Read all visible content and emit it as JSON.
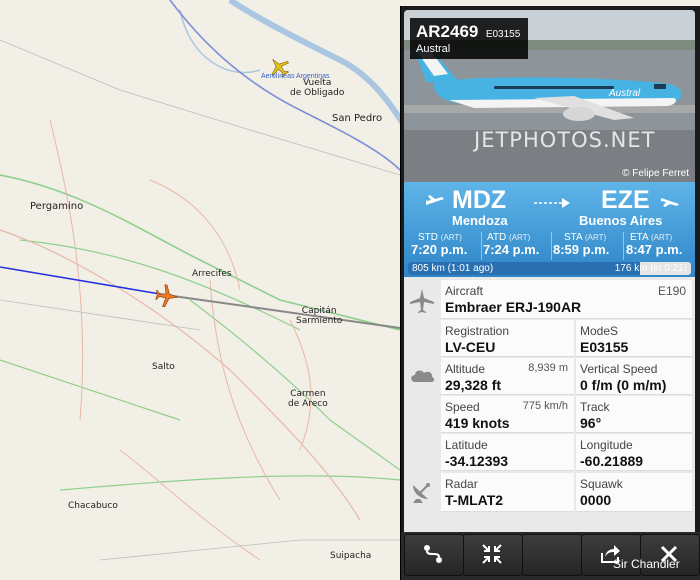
{
  "map": {
    "cities": [
      {
        "name": "Vuelta de Obligado",
        "line1": "Vuelta",
        "line2": "de Obligado"
      },
      {
        "name": "San Pedro"
      },
      {
        "name": "Pergamino"
      },
      {
        "name": "Arrecifes"
      },
      {
        "name": "Capitán Sarmiento",
        "line1": "Capitán",
        "line2": "Sarmiento"
      },
      {
        "name": "Salto"
      },
      {
        "name": "Carmen de Areco",
        "line1": "Carmen",
        "line2": "de Areco"
      },
      {
        "name": "Chacabuco"
      },
      {
        "name": "Suipacha"
      }
    ],
    "airport_label": "Aerolíneas Argentinas",
    "route_color_flown": "#2233dd",
    "route_color_remaining": "#888888"
  },
  "panel": {
    "callsign": "AR2469",
    "hex": "E03155",
    "airline": "Austral",
    "photo_watermark": "JETPHOTOS.NET",
    "photo_credit": "© Felipe Ferret",
    "origin": {
      "code": "MDZ",
      "city": "Mendoza"
    },
    "destination": {
      "code": "EZE",
      "city": "Buenos Aires"
    },
    "times": [
      {
        "label": "STD",
        "tz": "(ART)",
        "value": "7:20 p.m."
      },
      {
        "label": "ATD",
        "tz": "(ART)",
        "value": "7:24 p.m."
      },
      {
        "label": "STA",
        "tz": "(ART)",
        "value": "8:59 p.m."
      },
      {
        "label": "ETA",
        "tz": "(ART)",
        "value": "8:47 p.m."
      }
    ],
    "progress": {
      "flown_text": "805 km (1:01 ago)",
      "remaining_text": "176 km (in 0:21)",
      "fraction": 0.82
    },
    "aircraft": {
      "label": "Aircraft",
      "code": "E190",
      "value": "Embraer ERJ-190AR"
    },
    "registration": {
      "label": "Registration",
      "value": "LV-CEU"
    },
    "modes": {
      "label": "ModeS",
      "value": "E03155"
    },
    "altitude": {
      "label": "Altitude",
      "sub": "8,939 m",
      "value": "29,328 ft"
    },
    "vspeed": {
      "label": "Vertical Speed",
      "value": "0 f/m (0 m/m)"
    },
    "speed": {
      "label": "Speed",
      "sub": "775 km/h",
      "value": "419 knots"
    },
    "track": {
      "label": "Track",
      "value": "96°"
    },
    "latitude": {
      "label": "Latitude",
      "value": "-34.12393"
    },
    "longitude": {
      "label": "Longitude",
      "value": "-60.21889"
    },
    "radar": {
      "label": "Radar",
      "value": "T-MLAT2"
    },
    "squawk": {
      "label": "Squawk",
      "value": "0000"
    },
    "user": "Sir Chandler",
    "colors": {
      "header_blue": "#3a93d6",
      "panel_bg": "#1b1b1b"
    }
  }
}
